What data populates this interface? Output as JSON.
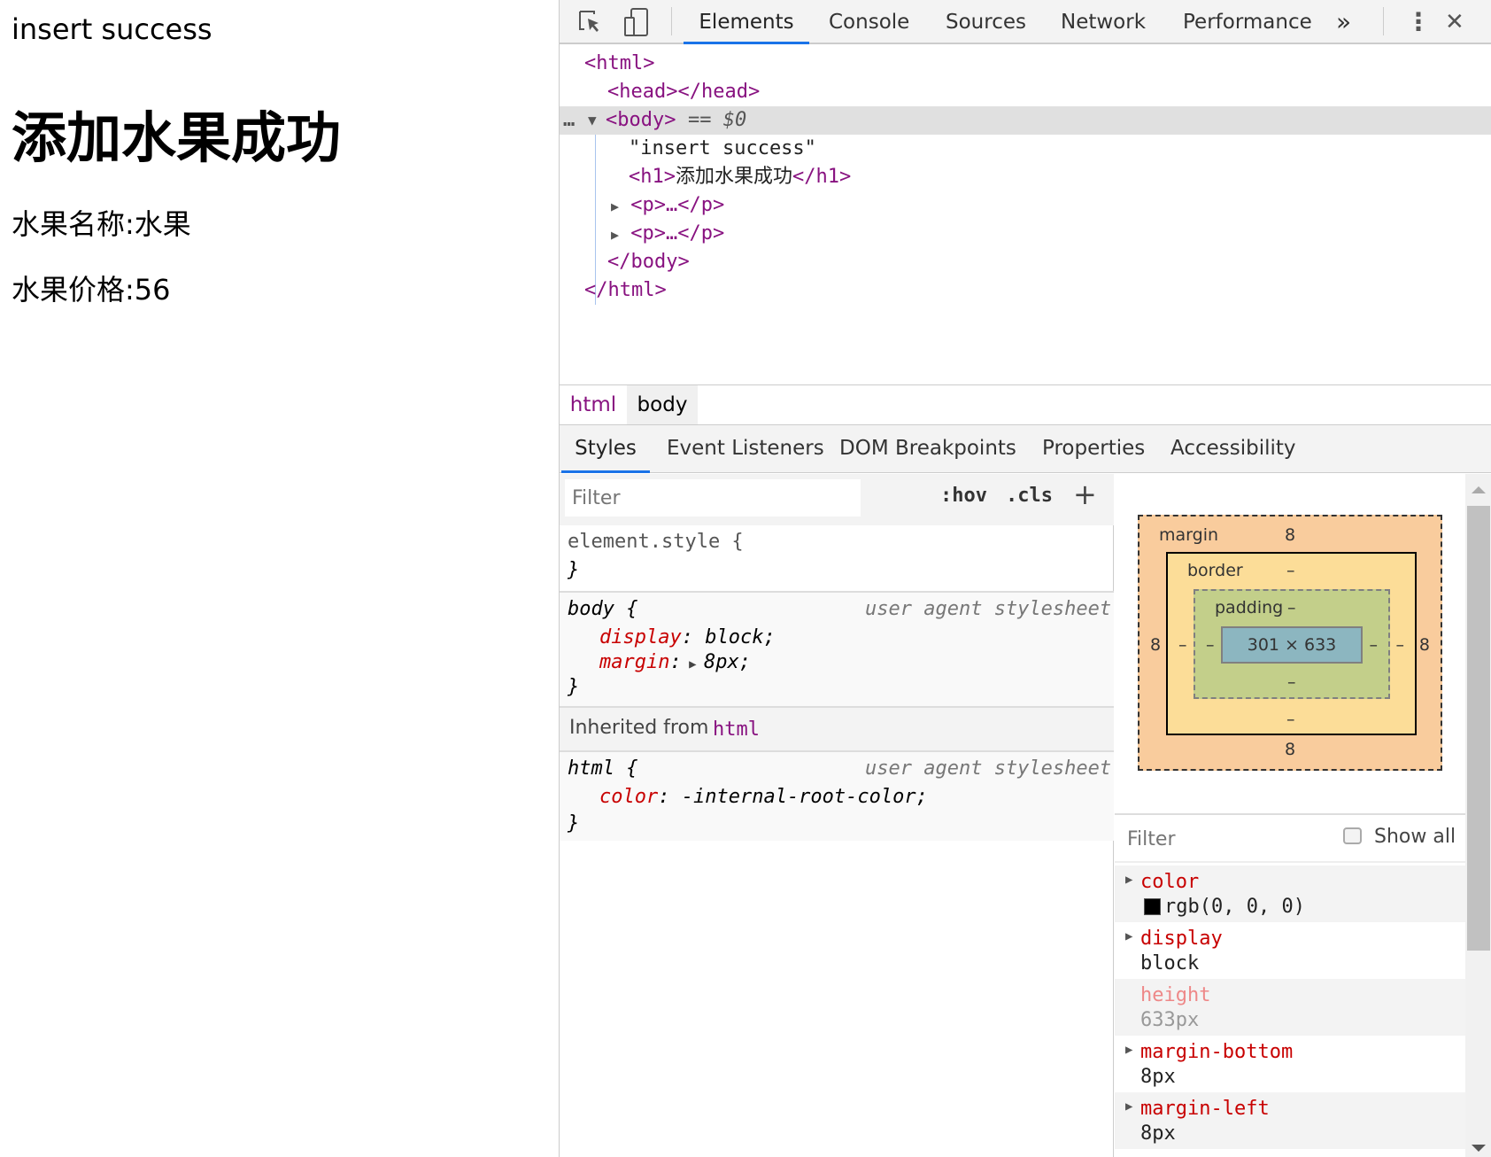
{
  "page": {
    "text": "insert success",
    "heading": "添加水果成功",
    "fruit_name": "水果名称:水果",
    "fruit_price": "水果价格:56"
  },
  "devtools": {
    "toolbar": {
      "tabs": [
        "Elements",
        "Console",
        "Sources",
        "Network",
        "Performance"
      ],
      "active_tab": "Elements",
      "more_tabs": "»",
      "menu": "⋮",
      "close": "✕"
    },
    "dom_tree": {
      "html_open": "<html>",
      "head": "<head></head>",
      "body_open": "<body>",
      "body_marker": "== $0",
      "ellipsis": "…",
      "text_node": "\"insert success\"",
      "h1_open": "<h1>",
      "h1_text": "添加水果成功",
      "h1_close": "</h1>",
      "p_collapsed": "<p>…</p>",
      "body_close": "</body>",
      "html_close": "</html>"
    },
    "breadcrumbs": [
      "html",
      "body"
    ],
    "subtabs": [
      "Styles",
      "Event Listeners",
      "DOM Breakpoints",
      "Properties",
      "Accessibility"
    ],
    "active_subtab": "Styles",
    "styles": {
      "filter_placeholder": "Filter",
      "hov": ":hov",
      "cls": ".cls",
      "add": "+",
      "element_style_open": "element.style {",
      "close_brace": "}",
      "body_selector": "body {",
      "source": "user agent stylesheet",
      "body_props": [
        {
          "name": "display",
          "value": "block;"
        },
        {
          "name": "margin",
          "value": "8px;"
        }
      ],
      "inherited_label": "Inherited from",
      "inherited_tag": "html",
      "html_selector": "html {",
      "html_props": [
        {
          "name": "color",
          "value": "-internal-root-color;"
        }
      ]
    },
    "box_model": {
      "margin_label": "margin",
      "border_label": "border",
      "padding_label": "padding",
      "margin": {
        "top": "8",
        "right": "8",
        "bottom": "8",
        "left": "8"
      },
      "border": {
        "top": "–",
        "right": "–",
        "bottom": "–",
        "left": "–"
      },
      "padding": {
        "top": "–",
        "right": "–",
        "bottom": "–",
        "left": "–"
      },
      "content": "301 × 633",
      "colors": {
        "margin": "#f9cc9d",
        "border": "#fcdd98",
        "padding": "#c3cf8a",
        "content": "#8cb6c0"
      }
    },
    "computed": {
      "filter_placeholder": "Filter",
      "show_all": "Show all",
      "show_all_checked": false,
      "props": [
        {
          "name": "color",
          "value": "rgb(0, 0, 0)",
          "swatch": "#000000",
          "expandable": true,
          "inherited": false
        },
        {
          "name": "display",
          "value": "block",
          "expandable": true,
          "inherited": false
        },
        {
          "name": "height",
          "value": "633px",
          "expandable": false,
          "inherited": true
        },
        {
          "name": "margin-bottom",
          "value": "8px",
          "expandable": true,
          "inherited": false
        },
        {
          "name": "margin-left",
          "value": "8px",
          "expandable": true,
          "inherited": false
        }
      ]
    }
  }
}
